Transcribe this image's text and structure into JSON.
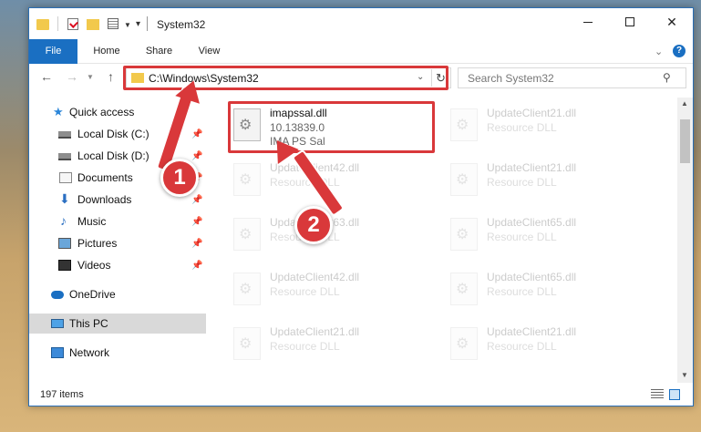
{
  "window": {
    "title": "System32"
  },
  "ribbon": {
    "tabs": [
      "File",
      "Home",
      "Share",
      "View"
    ]
  },
  "address": {
    "path": "C:\\Windows\\System32",
    "search_placeholder": "Search System32"
  },
  "navpane": {
    "items": [
      {
        "label": "Quick access",
        "pinned": false
      },
      {
        "label": "Local Disk (C:)",
        "pinned": true
      },
      {
        "label": "Local Disk (D:)",
        "pinned": true
      },
      {
        "label": "Documents",
        "pinned": true
      },
      {
        "label": "Downloads",
        "pinned": true
      },
      {
        "label": "Music",
        "pinned": true
      },
      {
        "label": "Pictures",
        "pinned": true
      },
      {
        "label": "Videos",
        "pinned": true
      },
      {
        "label": "OneDrive",
        "pinned": false
      },
      {
        "label": "This PC",
        "pinned": false,
        "selected": true
      },
      {
        "label": "Network",
        "pinned": false
      }
    ]
  },
  "files": [
    {
      "name": "imapssal.dll",
      "line2": "10.13839.0",
      "line3": "IMA PS Sal",
      "highlighted": true
    },
    {
      "name": "UpdateClient21.dll",
      "line2": "Resource DLL"
    },
    {
      "name": "UpdateClient42.dll",
      "line2": "Resource DLL"
    },
    {
      "name": "UpdateClient21.dll",
      "line2": "Resource DLL"
    },
    {
      "name": "UpdateClient63.dll",
      "line2": "Resource DLL"
    },
    {
      "name": "UpdateClient65.dll",
      "line2": "Resource DLL"
    },
    {
      "name": "UpdateClient42.dll",
      "line2": "Resource DLL"
    },
    {
      "name": "UpdateClient65.dll",
      "line2": "Resource DLL"
    },
    {
      "name": "UpdateClient21.dll",
      "line2": "Resource DLL"
    },
    {
      "name": "UpdateClient21.dll",
      "line2": "Resource DLL"
    }
  ],
  "status": {
    "item_count": "197 items"
  },
  "annotations": {
    "step1": "1",
    "step2": "2",
    "color": "#d9383a"
  }
}
